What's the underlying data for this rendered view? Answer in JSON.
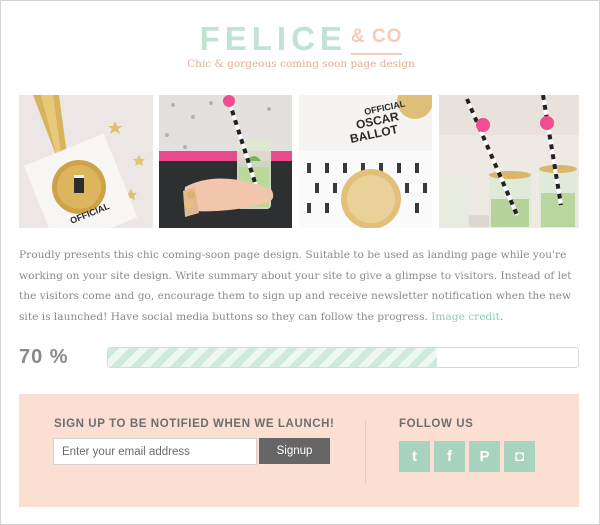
{
  "brand": {
    "name": "FELICE",
    "suffix": "& CO",
    "tagline": "Chic & gorgeous coming soon page design"
  },
  "gallery": {
    "photo1_caption": "OFFICIAL",
    "photo3_caption_line1": "OFFICIAL",
    "photo3_caption_line2": "OSCAR",
    "photo3_caption_line3": "BALLOT"
  },
  "description": {
    "text": "Proudly presents this chic coming-soon page design. Suitable to be used as landing page while you're working on your site design. Write summary about your site to give a glimpse to visitors. Instead of let the visitors come and go, encourage them to sign up and receive newsletter notification when the new site is launched! Have social media buttons so they can follow the progress. ",
    "link_label": "Image credit",
    "end": "."
  },
  "progress": {
    "label": "70 %",
    "value_percent": 70
  },
  "signup": {
    "title": "SIGN UP TO BE NOTIFIED WHEN WE LAUNCH!",
    "email_placeholder": "Enter your email address",
    "button_label": "Signup"
  },
  "follow": {
    "title": "FOLLOW US",
    "buttons": [
      {
        "icon": "twitter-icon",
        "glyph": "t"
      },
      {
        "icon": "facebook-icon",
        "glyph": "f"
      },
      {
        "icon": "pinterest-icon",
        "glyph": "P"
      },
      {
        "icon": "instagram-icon",
        "glyph": "◘"
      }
    ]
  },
  "colors": {
    "brand_mint": "#c2e3d3",
    "brand_peach": "#f2cdb7",
    "panel_bg": "#fbdfd2",
    "social_bg": "#a8d3be",
    "button_bg": "#666666",
    "link": "#8ecbb2"
  }
}
